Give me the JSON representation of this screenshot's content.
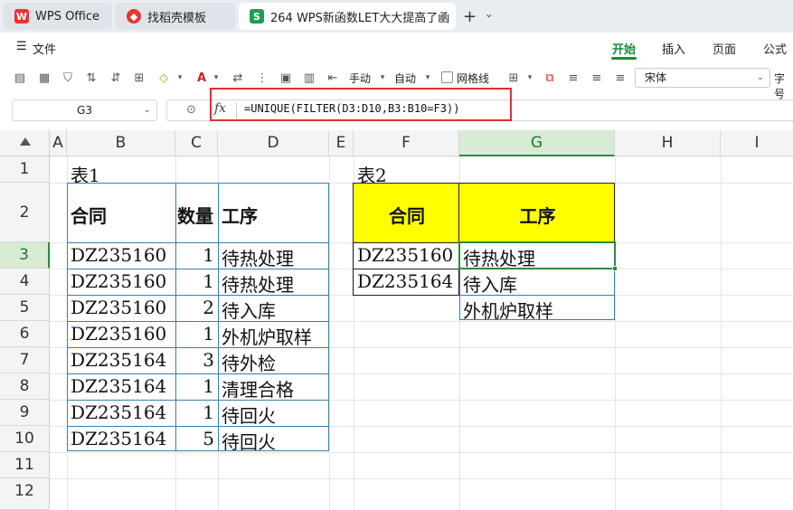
{
  "tabs": [
    {
      "label": "WPS Office",
      "icon": "wps-logo-icon"
    },
    {
      "label": "找稻壳模板",
      "icon": "docer-icon"
    },
    {
      "label": "264 WPS新函数LET大大提高了函",
      "icon": "sheet-icon"
    }
  ],
  "menu": {
    "file": "文件",
    "items": [
      "开始",
      "插入",
      "页面",
      "公式"
    ]
  },
  "toolbar": {
    "manual": "手动",
    "auto": "自动",
    "gridlines": "网格线",
    "font": "宋体",
    "fontsize_label": "字号"
  },
  "formula_bar": {
    "name_box": "G3",
    "formula": "=UNIQUE(FILTER(D3:D10,B3:B10=F3))"
  },
  "colors": {
    "accent": "#1a8a3a",
    "header_fill": "#ffff00",
    "highlight_box": "#e03030"
  },
  "columns": [
    "A",
    "B",
    "C",
    "D",
    "E",
    "F",
    "G",
    "H",
    "I"
  ],
  "rows": [
    "1",
    "2",
    "3",
    "4",
    "5",
    "6",
    "7",
    "8",
    "9",
    "10",
    "11",
    "12"
  ],
  "sheet": {
    "t1_title": "表1",
    "t1_headers": [
      "合同",
      "数量",
      "工序"
    ],
    "t1_rows": [
      [
        "DZ235160",
        "1",
        "待热处理"
      ],
      [
        "DZ235160",
        "1",
        "待热处理"
      ],
      [
        "DZ235160",
        "2",
        "待入库"
      ],
      [
        "DZ235160",
        "1",
        "外机炉取样"
      ],
      [
        "DZ235164",
        "3",
        "待外检"
      ],
      [
        "DZ235164",
        "1",
        "清理合格"
      ],
      [
        "DZ235164",
        "1",
        "待回火"
      ],
      [
        "DZ235164",
        "5",
        "待回火"
      ]
    ],
    "t2_title": "表2",
    "t2_headers": [
      "合同",
      "工序"
    ],
    "t2_contracts": [
      "DZ235160",
      "DZ235164"
    ],
    "t2_results": [
      "待热处理",
      "待入库",
      "外机炉取样"
    ]
  }
}
